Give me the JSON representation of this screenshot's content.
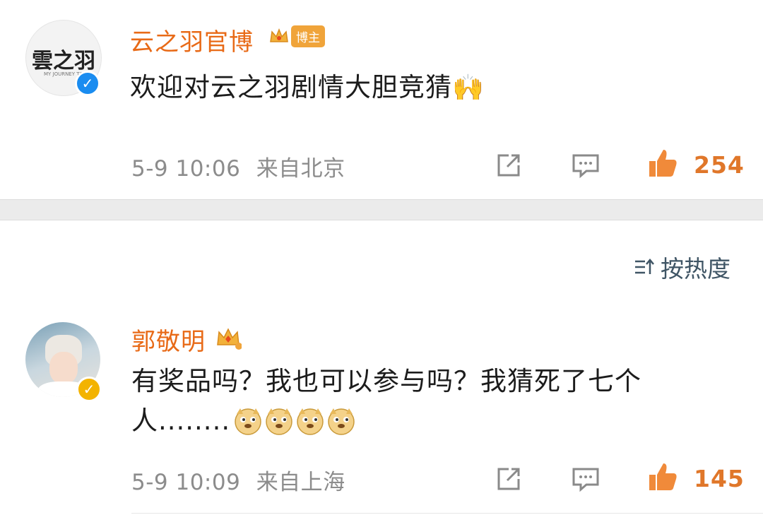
{
  "post": {
    "author": "云之羽官博",
    "author_badge": "博主",
    "avatar_text": "雲之羽",
    "avatar_sub": "MY JOURNEY TO",
    "content": "欢迎对云之羽剧情大胆竞猜",
    "content_emoji": "🙌",
    "time": "5-9 10:06",
    "location": "来自北京",
    "likes": "254"
  },
  "sort": {
    "label": "按热度",
    "icon": "sort-icon"
  },
  "comments": [
    {
      "author": "郭敬明",
      "content_line1": "有奖品吗？我也可以参与吗？我猜死了七个",
      "content_line2": "人........",
      "emoji": [
        "doge",
        "doge",
        "doge",
        "doge"
      ],
      "time": "5-9 10:09",
      "location": "来自上海",
      "likes": "145"
    }
  ],
  "colors": {
    "accent": "#e86a17",
    "like": "#e0772a",
    "verified_blue": "#1a8cf0",
    "verified_gold": "#f3b300"
  }
}
